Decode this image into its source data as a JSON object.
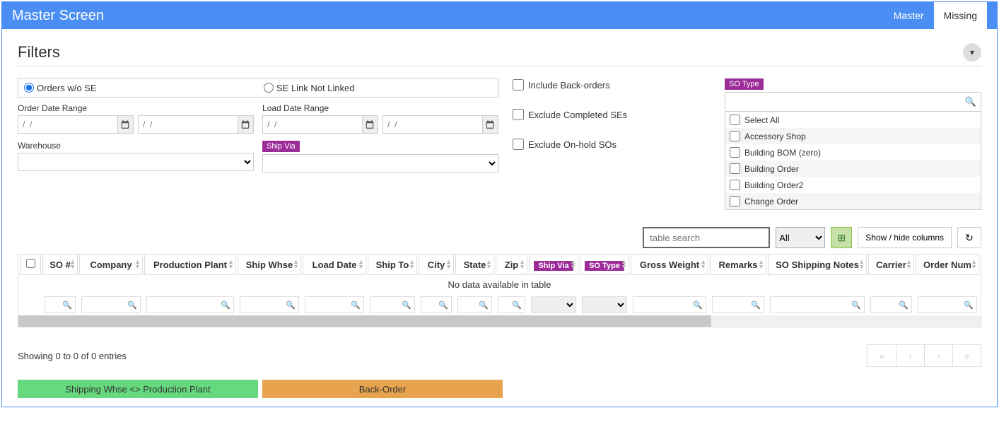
{
  "header": {
    "title": "Master Screen",
    "tabs": [
      "Master",
      "Missing"
    ],
    "activeTab": 1
  },
  "filters": {
    "title": "Filters",
    "radios": {
      "orders_wo_se": "Orders w/o SE",
      "se_link_not_linked": "SE Link Not Linked"
    },
    "labels": {
      "order_date": "Order Date Range",
      "load_date": "Load Date Range",
      "warehouse": "Warehouse",
      "ship_via": "Ship Via"
    },
    "date_placeholder": "/  /",
    "checks": {
      "include_back": "Include Back-orders",
      "exclude_completed": "Exclude Completed SEs",
      "exclude_onhold": "Exclude On-hold SOs"
    },
    "sotype_label": "SO Type",
    "sotype_items": [
      "Select All",
      "Accessory Shop",
      "Building BOM (zero)",
      "Building Order",
      "Building Order2",
      "Change Order"
    ]
  },
  "toolbar": {
    "search_ph": "table search",
    "all": "All",
    "showhide": "Show / hide columns"
  },
  "table": {
    "columns": [
      "",
      "SO #",
      "Company",
      "Production Plant",
      "Ship Whse",
      "Load Date",
      "Ship To",
      "City",
      "State",
      "Zip",
      "Ship Via",
      "SO Type",
      "Gross Weight",
      "Remarks",
      "SO Shipping Notes",
      "Carrier",
      "Order Num"
    ],
    "hlt_cols": [
      10,
      11
    ],
    "no_data": "No data available in table"
  },
  "footer": {
    "info": "Showing 0 to 0 of 0 entries"
  },
  "legends": {
    "green": "Shipping Whse <> Production Plant",
    "orange": "Back-Order"
  }
}
